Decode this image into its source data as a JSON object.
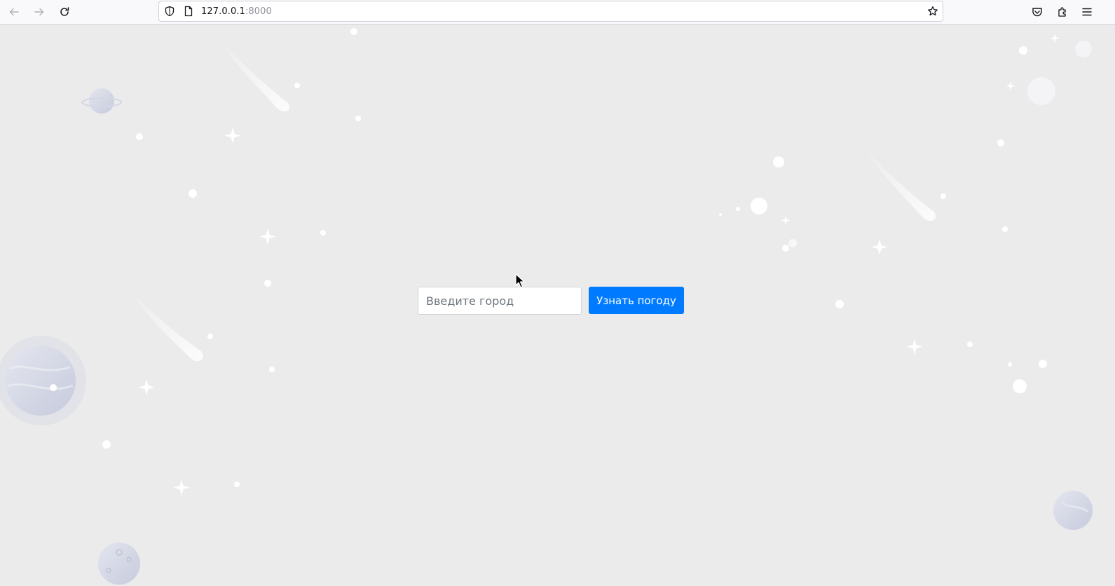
{
  "browser": {
    "url_host": "127.0.0.1",
    "url_port": ":8000",
    "icons": [
      "back-arrow-icon",
      "forward-arrow-icon",
      "reload-icon",
      "shield-icon",
      "page-icon",
      "bookmark-star-icon",
      "pocket-icon",
      "extensions-icon",
      "menu-icon"
    ]
  },
  "form": {
    "city_placeholder": "Введите город",
    "city_value": "",
    "submit_label": "Узнать погоду"
  },
  "colors": {
    "page_background": "#ebebeb",
    "button_background": "#007bff",
    "button_text": "#ffffff"
  }
}
